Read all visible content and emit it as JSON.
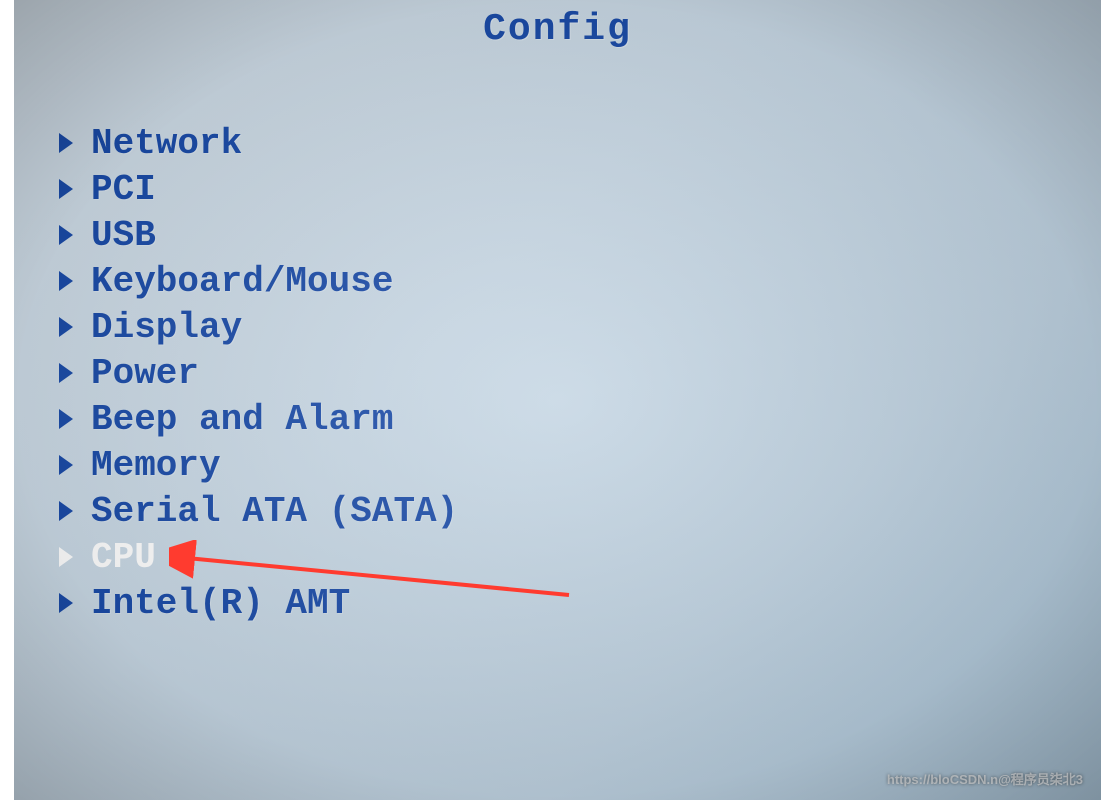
{
  "title": "Config",
  "menu": {
    "items": [
      {
        "label": "Network",
        "selected": false
      },
      {
        "label": "PCI",
        "selected": false
      },
      {
        "label": "USB",
        "selected": false
      },
      {
        "label": "Keyboard/Mouse",
        "selected": false
      },
      {
        "label": "Display",
        "selected": false
      },
      {
        "label": "Power",
        "selected": false
      },
      {
        "label": "Beep and Alarm",
        "selected": false
      },
      {
        "label": "Memory",
        "selected": false
      },
      {
        "label": "Serial ATA (SATA)",
        "selected": false
      },
      {
        "label": "CPU",
        "selected": true
      },
      {
        "label": "Intel(R) AMT",
        "selected": false
      }
    ]
  },
  "watermark": "https://bloCSDN.n@程序员柒北3"
}
